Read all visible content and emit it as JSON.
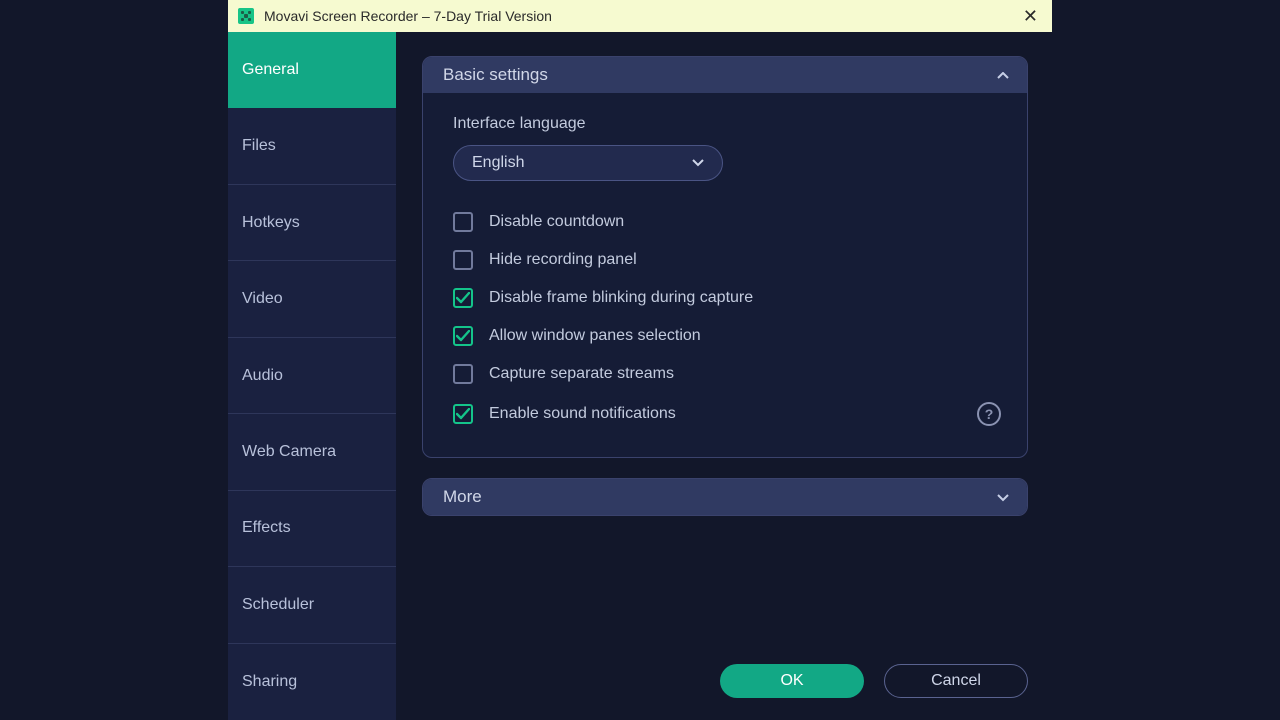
{
  "window": {
    "title": "Movavi Screen Recorder – 7-Day Trial Version"
  },
  "sidebar": {
    "tabs": [
      {
        "label": "General",
        "active": true
      },
      {
        "label": "Files",
        "active": false
      },
      {
        "label": "Hotkeys",
        "active": false
      },
      {
        "label": "Video",
        "active": false
      },
      {
        "label": "Audio",
        "active": false
      },
      {
        "label": "Web Camera",
        "active": false
      },
      {
        "label": "Effects",
        "active": false
      },
      {
        "label": "Scheduler",
        "active": false
      },
      {
        "label": "Sharing",
        "active": false
      }
    ]
  },
  "panels": {
    "basic": {
      "title": "Basic settings",
      "language_label": "Interface language",
      "language_value": "English",
      "checks": [
        {
          "label": "Disable countdown",
          "checked": false
        },
        {
          "label": "Hide recording panel",
          "checked": false
        },
        {
          "label": "Disable frame blinking during capture",
          "checked": true
        },
        {
          "label": "Allow window panes selection",
          "checked": true
        },
        {
          "label": "Capture separate streams",
          "checked": false
        },
        {
          "label": "Enable sound notifications",
          "checked": true,
          "help": true
        }
      ]
    },
    "more": {
      "title": "More"
    }
  },
  "footer": {
    "ok": "OK",
    "cancel": "Cancel"
  }
}
